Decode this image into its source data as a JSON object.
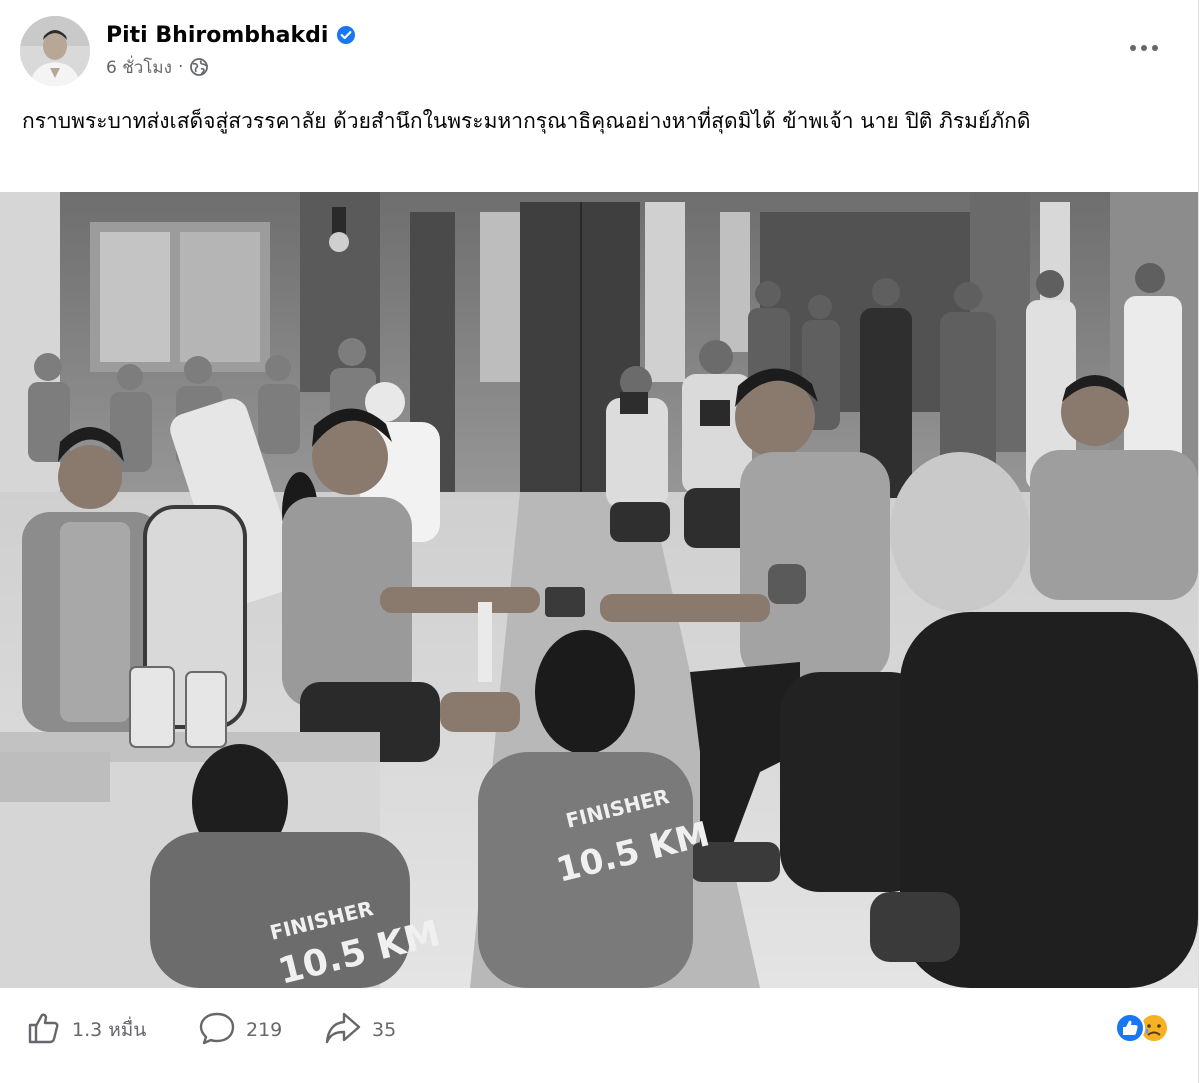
{
  "post": {
    "author": "Piti Bhirombhakdi",
    "timestamp": "6 ชั่วโมง",
    "separator": "·",
    "caption": "กราบพระบาทส่งเสด็จสู่สวรรคาลัย ด้วยสำนึกในพระมหากรุณาธิคุณอย่างหาที่สุดมิได้ ข้าพเจ้า นาย ปิติ ภิรมย์ภักดิ",
    "photo_text": {
      "shirt_left": "FINISHER\n10.5 KM",
      "shirt_left_line1": "FINISHER",
      "shirt_left_line2": "10.5 KM",
      "shirt_right_line1": "FINISHER",
      "shirt_right_line2": "10.5 KM"
    }
  },
  "engagement": {
    "likes": "1.3 หมื่น",
    "comments": "219",
    "shares": "35"
  },
  "icons": {
    "verified": "verified-badge-icon",
    "audience": "globe-icon",
    "more": "more-options-icon",
    "like": "thumbs-up-icon",
    "comment": "comment-icon",
    "share": "share-icon",
    "reactions": [
      "like-reaction-icon",
      "sad-reaction-icon"
    ]
  },
  "colors": {
    "verified_blue": "#1877f2",
    "secondary_text": "#65676b",
    "sad_yellow": "#f7b125"
  }
}
